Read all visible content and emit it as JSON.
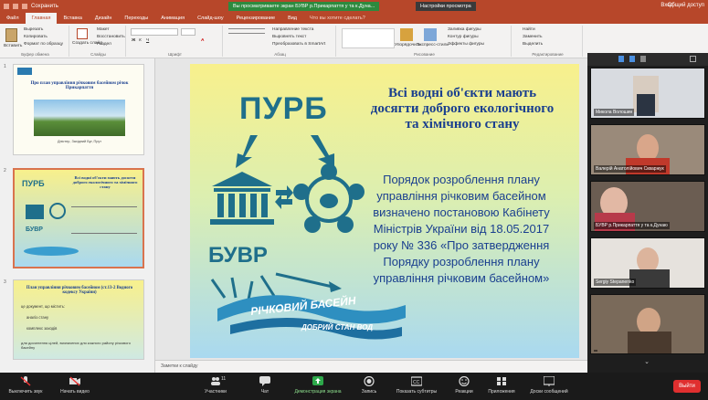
{
  "window": {
    "left_title": "Сохранить",
    "share_banner": "Вы просматриваете экран БУВР р.Прикарпаття у та к.Дуна...",
    "share_options": "Настройки просмотра",
    "user": "Вход",
    "share_button": "Общий доступ"
  },
  "ribbon_tabs": [
    "Файл",
    "Главная",
    "Вставка",
    "Дизайн",
    "Переходы",
    "Анимация",
    "Слайд-шоу",
    "Рецензирование",
    "Вид",
    "Что вы хотите сделать?"
  ],
  "ribbon": {
    "paste": "Вставить",
    "cut": "Вырезать",
    "copy": "Копировать",
    "format": "Формат по образцу",
    "clipboard": "Буфер обмена",
    "new_slide": "Создать слайд",
    "layout": "Макет",
    "reset": "Восстановить",
    "section": "Раздел",
    "slides": "Слайды",
    "font": "Шрифт",
    "paragraph": "Абзац",
    "text_dir": "Направление текста",
    "align_text": "Выровнять текст",
    "smartart": "Преобразовать в SmartArt",
    "drawing": "Рисование",
    "arrange": "Упорядочить",
    "quick_styles": "Экспресс-стили",
    "shape_fill": "Заливка фигуры",
    "shape_outline": "Контур фигуры",
    "shape_effects": "Эффекты фигуры",
    "find": "Найти",
    "replace": "Заменить",
    "select": "Выделить",
    "editing": "Редактирование"
  },
  "thumbnails": [
    {
      "num": "1",
      "title": "Про план управління річковим басейном річок Прикарпаття",
      "caption": "Дністер, Західний Буг, Прут"
    },
    {
      "num": "2",
      "title": "Всі водні об'єкти мають досягти доброго екологічного та хімічного стану",
      "purb": "ПУРБ",
      "buvr": "БУВР"
    },
    {
      "num": "3",
      "title": "План управління річковим басейном (ст.13-2 Водного кодексу України)",
      "b1": "це документ, що містить:",
      "b2": "аналіз стану",
      "b3": "комплекс заходів",
      "b4": "для досягнення цілей, визначених для кожного району річкового басейну"
    }
  ],
  "slide": {
    "purb": "ПУРБ",
    "buvr": "БУВР",
    "title_1": "Всі водні об'єкти мають",
    "title_2": "досягти доброго екологічного",
    "title_3": "та хімічного стану",
    "body": [
      "Порядок розроблення плану",
      "управління річковим басейном",
      "визначено постановою Кабінету",
      "Міністрів України від 18.05.2017",
      "року № 336  «Про затвердження",
      "Порядку розроблення плану",
      "управління річковим басейном»"
    ],
    "logo_1": "РІЧКОВИЙ БАСЕЙН",
    "logo_2": "ДОБРИЙ СТАН ВОД"
  },
  "notes_placeholder": "Заметки к слайду",
  "participants": [
    {
      "name": "Микола Волошин"
    },
    {
      "name": "Валерій Анатолійович Скваржук"
    },
    {
      "name": "БУВР р.Прикарпаття у та к.Дунаю"
    },
    {
      "name": "Sergiy Stepanenko"
    },
    {
      "name": ""
    }
  ],
  "toolbar": {
    "mute": "Выключить звук",
    "video": "Начать видео",
    "participants": "Участники",
    "participants_count": "11",
    "chat": "Чат",
    "share": "Демонстрация экрана",
    "record": "Запись",
    "captions": "Показать субтитры",
    "reactions": "Реакции",
    "apps": "Приложения",
    "whiteboard": "Доски сообщений",
    "end": "Выйти"
  },
  "colors": {
    "ribbon": "#b7472a",
    "share_green": "#2d8a3e",
    "end_red": "#e02f2f",
    "slide_blue": "#1f6f8b"
  }
}
